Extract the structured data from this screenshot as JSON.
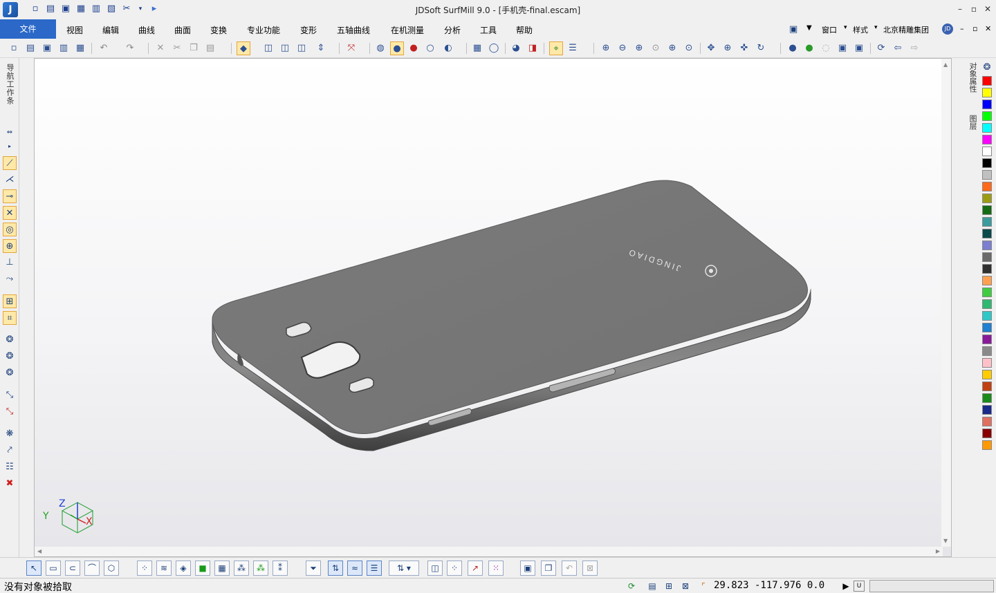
{
  "window": {
    "title": "JDSoft SurfMill 9.0 - [手机壳-final.escam]",
    "logo_icon": "app-logo-icon",
    "controls": [
      "minimize-icon",
      "restore-icon",
      "close-icon"
    ]
  },
  "quick_access": [
    "new-file-icon",
    "open-file-icon",
    "save-icon",
    "save-as-icon",
    "print-icon",
    "save-copy-icon",
    "tools-icon",
    "run-icon"
  ],
  "menubar": {
    "file": "文件",
    "items": [
      "视图",
      "编辑",
      "曲线",
      "曲面",
      "变换",
      "专业功能",
      "变形",
      "五轴曲线",
      "在机测量",
      "分析",
      "工具",
      "帮助"
    ],
    "window": "窗口",
    "style": "样式",
    "company": "北京精雕集团"
  },
  "sidebar_left": {
    "tab_label": "导航工作条"
  },
  "sidebar_right": {
    "properties_tab": "对象属性",
    "layers_tab": "图层",
    "palette": [
      "#ff0000",
      "#ffff00",
      "#0000ff",
      "#00ff00",
      "#00ffff",
      "#ff00ff",
      "#ffffff",
      "#000000",
      "#c0c0c0",
      "#ff6a1a",
      "#9c9c14",
      "#156b15",
      "#3a9c9c",
      "#0a4a4a",
      "#7a7fd0",
      "#6a6a6a",
      "#303030",
      "#ffa050",
      "#40cc40",
      "#2fb870",
      "#2fc8c8",
      "#1f7fd0",
      "#8a1a9a",
      "#8a8a8a",
      "#ffc0c8",
      "#ffcc00",
      "#c04010",
      "#1a8a1a",
      "#1a2a8a",
      "#e07060",
      "#8a0000",
      "#ff9900"
    ]
  },
  "model": {
    "brand_text": "JINGDIAO"
  },
  "axis": {
    "x": "X",
    "y": "Y",
    "z": "Z"
  },
  "status": {
    "message": "没有对象被拾取",
    "coords": "29.823  -117.976  0.0",
    "unit": "U"
  }
}
